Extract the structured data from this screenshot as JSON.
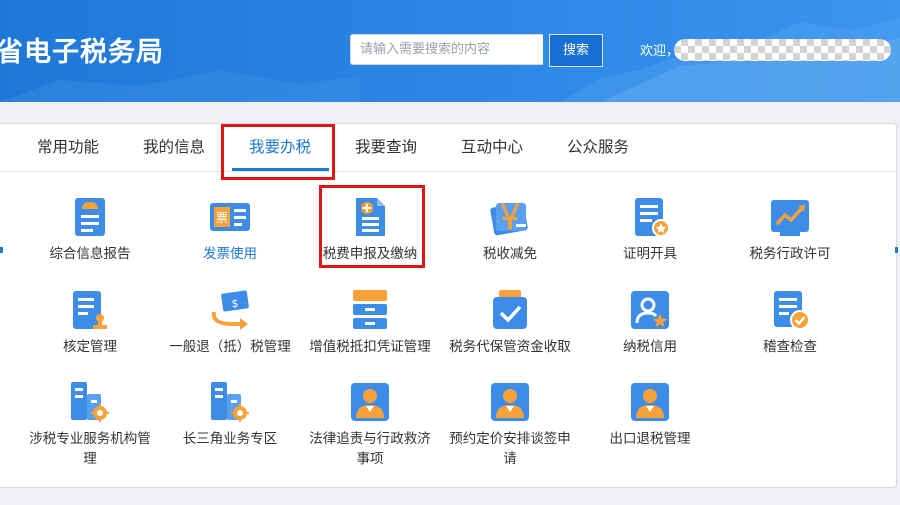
{
  "header": {
    "title": "省电子税务局",
    "search_placeholder": "请输入需要搜索的内容",
    "search_button": "搜索",
    "welcome": "欢迎，"
  },
  "tabs": [
    {
      "label": "常用功能",
      "active": false
    },
    {
      "label": "我的信息",
      "active": false
    },
    {
      "label": "我要办税",
      "active": true
    },
    {
      "label": "我要查询",
      "active": false
    },
    {
      "label": "互动中心",
      "active": false
    },
    {
      "label": "公众服务",
      "active": false
    }
  ],
  "tiles": [
    {
      "label": "综合信息报告",
      "icon": "report-icon"
    },
    {
      "label": "发票使用",
      "icon": "invoice-icon"
    },
    {
      "label": "税费申报及缴纳",
      "icon": "tax-declare-icon"
    },
    {
      "label": "税收减免",
      "icon": "tax-relief-icon"
    },
    {
      "label": "证明开具",
      "icon": "certificate-icon"
    },
    {
      "label": "税务行政许可",
      "icon": "admin-permit-icon"
    },
    {
      "label": "核定管理",
      "icon": "assessment-icon"
    },
    {
      "label": "一般退（抵）税管理",
      "icon": "tax-refund-icon"
    },
    {
      "label": "增值税抵扣凭证管理",
      "icon": "vat-voucher-icon"
    },
    {
      "label": "税务代保管资金收取",
      "icon": "fund-custody-icon"
    },
    {
      "label": "纳税信用",
      "icon": "tax-credit-icon"
    },
    {
      "label": "稽查检查",
      "icon": "inspection-icon"
    },
    {
      "label": "涉税专业服务机构管理",
      "icon": "agency-icon"
    },
    {
      "label": "长三角业务专区",
      "icon": "yangtze-zone-icon"
    },
    {
      "label": "法律追责与行政救济事项",
      "icon": "legal-remedy-icon"
    },
    {
      "label": "预约定价安排谈签申请",
      "icon": "pricing-arrangement-icon"
    },
    {
      "label": "出口退税管理",
      "icon": "export-refund-icon"
    }
  ],
  "colors": {
    "primary": "#1f78d8",
    "highlight": "#e01616",
    "icon_orange": "#f7a13a"
  }
}
